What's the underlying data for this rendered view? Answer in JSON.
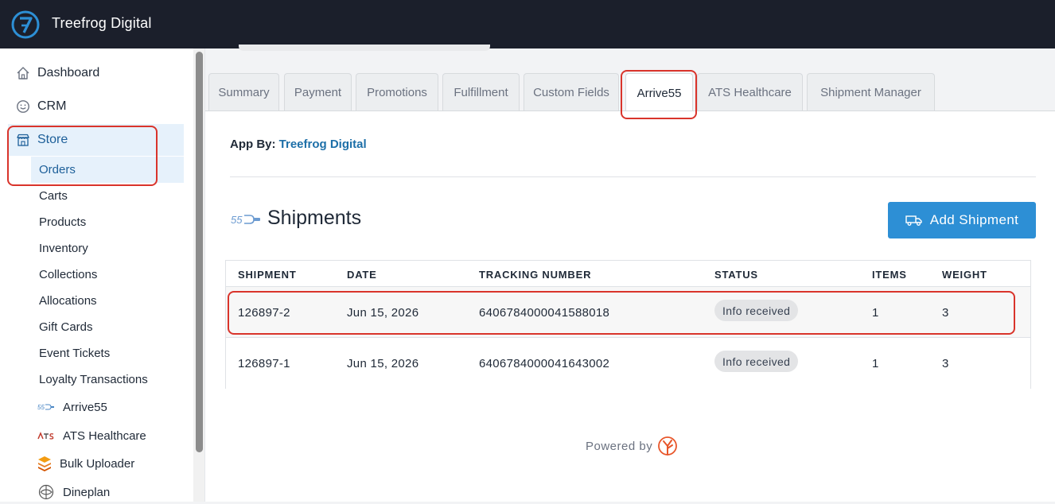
{
  "app": {
    "brand": "Treefrog Digital"
  },
  "sidebar": {
    "items": [
      {
        "label": "Dashboard",
        "icon": "home-icon"
      },
      {
        "label": "CRM",
        "icon": "smile-icon"
      },
      {
        "label": "Store",
        "icon": "store-icon"
      }
    ],
    "store_children": [
      {
        "label": "Orders"
      },
      {
        "label": "Carts"
      },
      {
        "label": "Products"
      },
      {
        "label": "Inventory"
      },
      {
        "label": "Collections"
      },
      {
        "label": "Allocations"
      },
      {
        "label": "Gift Cards"
      },
      {
        "label": "Event Tickets"
      },
      {
        "label": "Loyalty Transactions"
      }
    ],
    "apps": [
      {
        "label": "Arrive55",
        "icon": "arrive55-logo-icon"
      },
      {
        "label": "ATS Healthcare",
        "icon": "ats-logo-icon"
      },
      {
        "label": "Bulk Uploader",
        "icon": "layers-icon"
      },
      {
        "label": "Dineplan",
        "icon": "dineplan-icon"
      }
    ]
  },
  "tabs": [
    {
      "label": "Summary"
    },
    {
      "label": "Payment"
    },
    {
      "label": "Promotions"
    },
    {
      "label": "Fulfillment"
    },
    {
      "label": "Custom Fields"
    },
    {
      "label": "Arrive55"
    },
    {
      "label": "ATS Healthcare"
    },
    {
      "label": "Shipment Manager"
    }
  ],
  "content": {
    "app_by_label": "App By:",
    "app_by_value": "Treefrog Digital",
    "section_title": "Shipments",
    "add_button": "Add Shipment",
    "powered_by": "Powered by"
  },
  "table": {
    "headers": [
      "SHIPMENT",
      "DATE",
      "TRACKING NUMBER",
      "STATUS",
      "ITEMS",
      "WEIGHT"
    ],
    "rows": [
      {
        "shipment": "126897-2",
        "date": "Jun 15, 2026",
        "tracking": "6406784000041588018",
        "status": "Info received",
        "items": "1",
        "weight": "3"
      },
      {
        "shipment": "126897-1",
        "date": "Jun 15, 2026",
        "tracking": "6406784000041643002",
        "status": "Info received",
        "items": "1",
        "weight": "3"
      }
    ]
  },
  "colors": {
    "topbar": "#1b1f2b",
    "accent": "#2d8fd5",
    "highlight": "#d9342b",
    "active_bg": "#e6f1fb"
  }
}
